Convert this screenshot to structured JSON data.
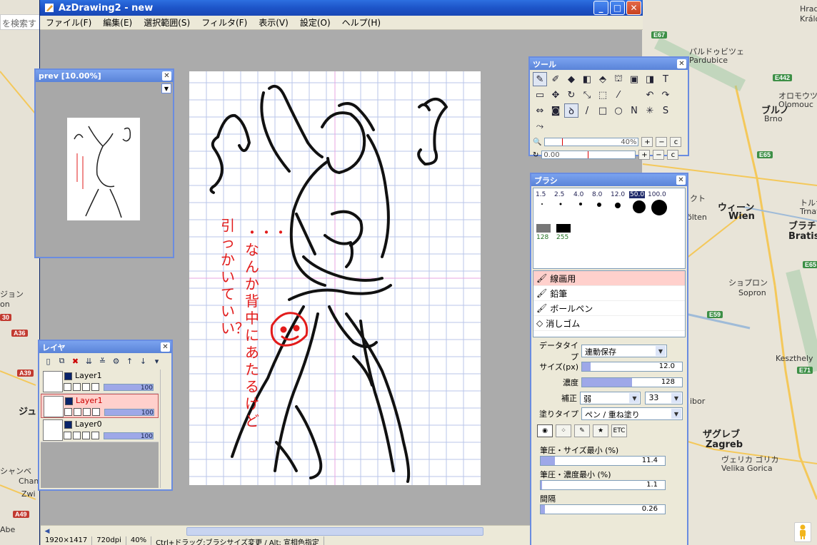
{
  "map": {
    "search_placeholder": "を検索す",
    "labels": [
      {
        "id": "hradec",
        "text": "Hradec"
      },
      {
        "id": "kralove",
        "text": "Králové"
      },
      {
        "id": "pardubice1",
        "text": "パルドゥビツェ"
      },
      {
        "id": "pardubice2",
        "text": "Pardubice"
      },
      {
        "id": "brno_jp",
        "text": "ブルノ"
      },
      {
        "id": "brno",
        "text": "Brno"
      },
      {
        "id": "olomouc_jp",
        "text": "オロモウツ"
      },
      {
        "id": "olomouc",
        "text": "Olomouc"
      },
      {
        "id": "wien_jp",
        "text": "ウィーン"
      },
      {
        "id": "wien",
        "text": "Wien"
      },
      {
        "id": "bratis_jp",
        "text": "ブラチ"
      },
      {
        "id": "bratis",
        "text": "Bratisl"
      },
      {
        "id": "sopron_jp",
        "text": "ショプロン"
      },
      {
        "id": "sopron",
        "text": "Sopron"
      },
      {
        "id": "trnava_jp",
        "text": "トルナバ"
      },
      {
        "id": "trnava",
        "text": "Trnava"
      },
      {
        "id": "keszthely",
        "text": "Keszthely"
      },
      {
        "id": "zagreb_jp",
        "text": "ザグレブ"
      },
      {
        "id": "zagreb",
        "text": "Zagreb"
      },
      {
        "id": "gorica_jp",
        "text": "ヴェリカ ゴリカ"
      },
      {
        "id": "gorica",
        "text": "Velika Gorica"
      },
      {
        "id": "tolten",
        "text": "ölten"
      },
      {
        "id": "ibor",
        "text": "ibor"
      },
      {
        "id": "kuto",
        "text": "クト"
      },
      {
        "id": "ju",
        "text": "ジュ"
      },
      {
        "id": "jon",
        "text": "ジョン"
      },
      {
        "id": "on",
        "text": "on"
      },
      {
        "id": "cham",
        "text": "Cham"
      },
      {
        "id": "shan",
        "text": "シャンベ"
      },
      {
        "id": "zwi",
        "text": "Zwi"
      },
      {
        "id": "aberry",
        "text": "Abe"
      }
    ],
    "roads": [
      {
        "id": "e67",
        "text": "E67"
      },
      {
        "id": "e442",
        "text": "E442"
      },
      {
        "id": "e65a",
        "text": "E65"
      },
      {
        "id": "e65b",
        "text": "E65"
      },
      {
        "id": "e59",
        "text": "E59"
      },
      {
        "id": "e71",
        "text": "E71"
      },
      {
        "id": "a39",
        "text": "A39"
      },
      {
        "id": "a36",
        "text": "A36"
      },
      {
        "id": "a49",
        "text": "A49"
      },
      {
        "id": "n30",
        "text": "30"
      }
    ]
  },
  "app": {
    "title": "AzDrawing2 - new",
    "window_buttons": {
      "minimize": "_",
      "maximize": "□",
      "close": "✕"
    },
    "menu": [
      "ファイル(F)",
      "編集(E)",
      "選択範囲(S)",
      "フィルタ(F)",
      "表示(V)",
      "設定(O)",
      "ヘルプ(H)"
    ],
    "status": [
      "1920×1417",
      "720dpi",
      "40%",
      "Ctrl+ドラッグ:ブラシサイズ変更 / Alt: 宣相色指定"
    ]
  },
  "canvas_text": {
    "note_a": "引っかいていい？",
    "note_b": "・・・なんか背中にあたるけど"
  },
  "prev_panel": {
    "title": "prev [10.00%]"
  },
  "tool_panel": {
    "title": "ツール",
    "zoom_value": "40%",
    "rotate_value": "0.00",
    "plus": "+",
    "minus": "−",
    "reset": "c"
  },
  "brush_panel": {
    "title": "ブラシ",
    "sizes": [
      "1.5",
      "2.5",
      "4.0",
      "8.0",
      "12.0",
      "50.0",
      "100.0"
    ],
    "opacities": [
      "128",
      "255"
    ],
    "brushes": [
      "線画用",
      "鉛筆",
      "ボールペン",
      "消しゴム"
    ],
    "data_type_label": "データタイプ",
    "data_type_value": "連動保存",
    "size_label": "サイズ(px)",
    "size_value": "12.0",
    "density_label": "濃度",
    "density_value": "128",
    "correction_label": "補正",
    "correction_value": "弱",
    "correction_num": "33",
    "paint_type_label": "塗りタイプ",
    "paint_type_value": "ペン / 重ね塗り",
    "pressure_size_label": "筆圧・サイズ最小 (%)",
    "pressure_size_value": "11.4",
    "pressure_density_label": "筆圧・濃度最小 (%)",
    "pressure_density_value": "1.1",
    "interval_label": "間隔",
    "interval_value": "0.26",
    "etc_label": "ETC"
  },
  "layer_panel": {
    "title": "レイヤ",
    "layers": [
      {
        "name": "Layer1",
        "opacity": "100"
      },
      {
        "name": "Layer1",
        "opacity": "100"
      },
      {
        "name": "Layer0",
        "opacity": "100"
      }
    ]
  }
}
